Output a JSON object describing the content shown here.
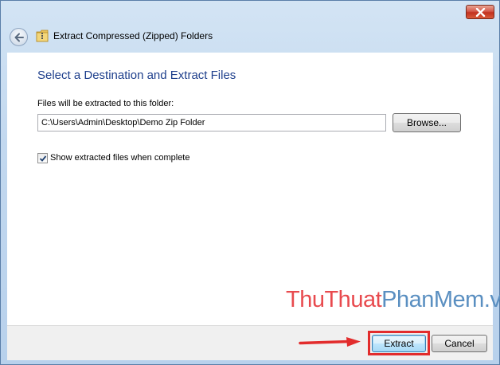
{
  "window": {
    "title": "Extract Compressed (Zipped) Folders"
  },
  "content": {
    "heading": "Select a Destination and Extract Files",
    "destination_label": "Files will be extracted to this folder:",
    "destination_path": "C:\\Users\\Admin\\Desktop\\Demo Zip Folder",
    "browse_label": "Browse...",
    "show_files_label": "Show extracted files when complete",
    "show_files_checked": true
  },
  "watermark": {
    "part1": "ThuThuat",
    "part2": "PhanMem",
    "part3": ".vn"
  },
  "footer": {
    "extract_label": "Extract",
    "cancel_label": "Cancel"
  },
  "colors": {
    "heading": "#1e3f8c",
    "highlight": "#e22c2c",
    "watermark_red": "#e84a4e",
    "watermark_blue": "#5a8fc1"
  },
  "icons": {
    "close": "close-icon",
    "back": "back-arrow-icon",
    "folder": "zip-folder-icon",
    "check": "checkmark-icon",
    "pointer_arrow": "red-arrow-icon"
  }
}
